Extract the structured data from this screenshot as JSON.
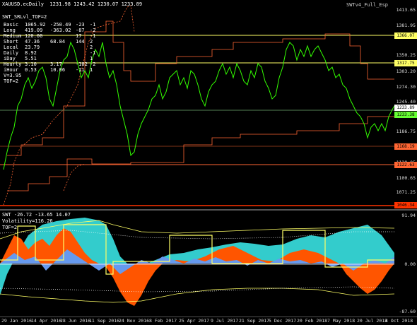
{
  "top_chart": {
    "symbol_info": "XAUUSD.ecDaily  1231.98 1243.42 1230.07 1233.89",
    "indicator_title": "SWT_SRLvl_TOF=2",
    "right_title": "SWTv4_Full_Esp",
    "table_rows": [
      {
        "label": "Basic",
        "v1": "1065.92",
        "v2": "-250.49",
        "v3": "-23",
        "v4": "-1"
      },
      {
        "label": "Long",
        "v1": "419.09",
        "v2": "-363.02",
        "v3": "-87",
        "v4": "-2"
      },
      {
        "label": "Medium",
        "v1": "120.00",
        "v2": "",
        "v3": "17",
        "v4": "-1"
      },
      {
        "label": "Short",
        "v1": "47.36",
        "v2": "68.84",
        "v3": "144",
        "v4": "2"
      },
      {
        "label": "Local",
        "v1": "23.79",
        "v2": "",
        "v3": "",
        "v4": "2"
      },
      {
        "label": "Daily",
        "v1": "8.92",
        "v2": "",
        "v3": "",
        "v4": "-1"
      },
      {
        "label": "iDay",
        "v1": "5.51",
        "v2": "",
        "v3": "",
        "v4": "1"
      },
      {
        "label": "Hourly",
        "v1": "3.10",
        "v2": "3.17",
        "v3": "-102",
        "v4": "-2"
      },
      {
        "label": "iHour",
        "v1": "0.53",
        "v2": "10.06",
        "v3": "-11",
        "v4": "1"
      }
    ],
    "extra_lines": [
      "V=3.95",
      "TOF=2"
    ],
    "y_ticks": [
      "1413.65",
      "1381.95",
      "1350.25",
      "1318.55",
      "1303.20",
      "1274.30",
      "1245.40",
      "1216.50",
      "1186.75",
      "1158.00",
      "1128.05",
      "1100.65",
      "1071.25",
      "1041.50"
    ],
    "level_tags": [
      {
        "text": "1366.07",
        "color": "#ffff66"
      },
      {
        "text": "1317.75",
        "color": "#ffff66"
      },
      {
        "text": "1233.89",
        "color": "#ffffff"
      },
      {
        "text": "1233.38",
        "color": "#66ff33"
      },
      {
        "text": "1168.19",
        "color": "#ff6633"
      },
      {
        "text": "1122.63",
        "color": "#ff6633"
      },
      {
        "text": "1046.34",
        "color": "#ff3300"
      }
    ]
  },
  "bottom_chart": {
    "title": "SWT -26.72 -13.65 14.07",
    "volatility": "Volatility=116.26",
    "tof": "TOF=2",
    "y_ticks": [
      "91.94",
      "0.00",
      "-87.60"
    ]
  },
  "x_axis": [
    "29 Jan 2016",
    "14 Apr 2016",
    "28 Jun 2016",
    "11 Sep 2016",
    "24 Nov 2016",
    "8 Feb 2017",
    "25 Apr 2017",
    "9 Jul 2017",
    "21 Sep 2017",
    "5 Dec 2017",
    "20 Feb 2018",
    "7 May 2018",
    "20 Jul 2018",
    "4 Oct 2018"
  ],
  "colors": {
    "price": "#33ff00",
    "resistance": "#ff6633",
    "yellow": "#ffff66",
    "cyan": "#33cccc",
    "orange": "#ff5500",
    "blue": "#6699ee"
  }
}
